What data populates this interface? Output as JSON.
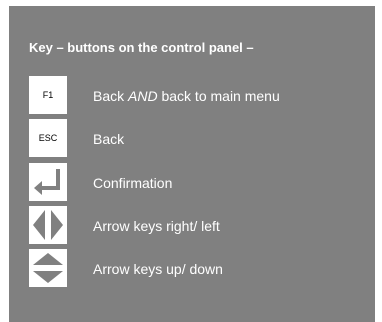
{
  "title": "Key – buttons on the control panel –",
  "rows": [
    {
      "key_text": "F1",
      "label_pre": "Back ",
      "label_em": "AND",
      "label_post": " back to main menu"
    },
    {
      "key_text": "ESC",
      "label": "Back"
    },
    {
      "icon": "enter-key-icon",
      "label": "Confirmation"
    },
    {
      "icon": "arrow-left-right-icon",
      "label": "Arrow keys right/ left"
    },
    {
      "icon": "arrow-up-down-icon",
      "label": "Arrow keys up/ down"
    }
  ],
  "colors": {
    "panel": "#808080",
    "key": "#ffffff",
    "text": "#ffffff"
  }
}
